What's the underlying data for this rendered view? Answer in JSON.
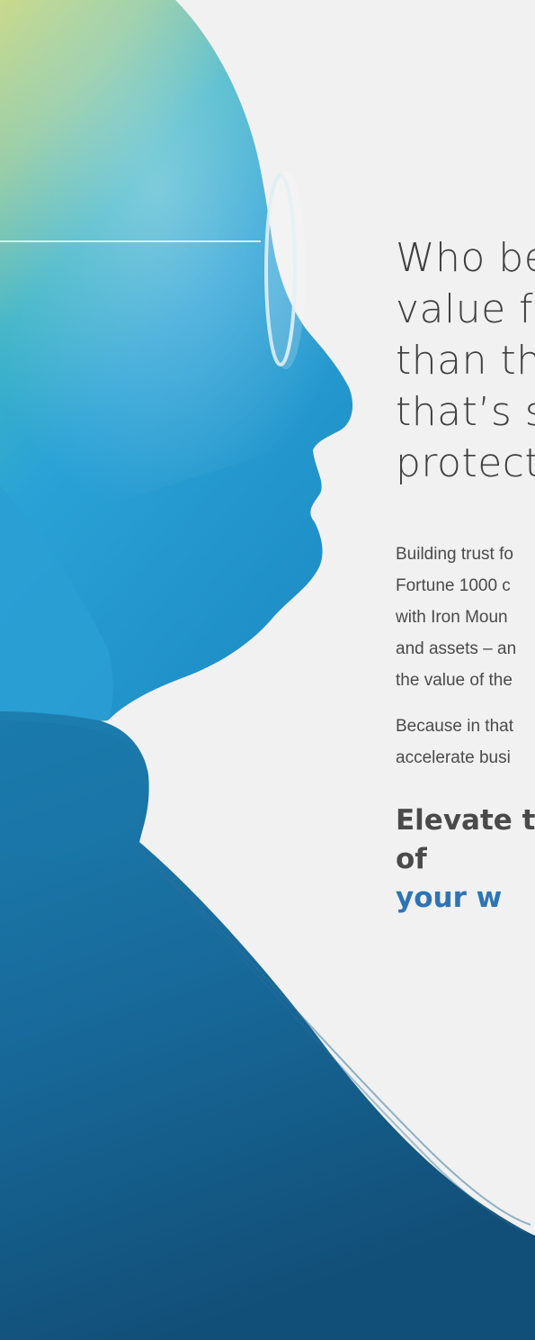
{
  "headline": {
    "lines": [
      "Who be",
      "value f",
      "than th",
      "that’s s",
      "protect"
    ]
  },
  "body": {
    "paragraph1": [
      "Building trust fo",
      "Fortune 1000 c",
      "with Iron Moun",
      "and assets – an",
      "the value of the"
    ],
    "paragraph2": [
      "Because in that",
      "accelerate busi"
    ]
  },
  "cta": {
    "line1": "Elevate t",
    "line2_prefix": "of ",
    "line2_accent": "your w"
  },
  "colors": {
    "background": "#f1f1f1",
    "text": "#4a4a4a",
    "accent": "#2e74b5"
  }
}
